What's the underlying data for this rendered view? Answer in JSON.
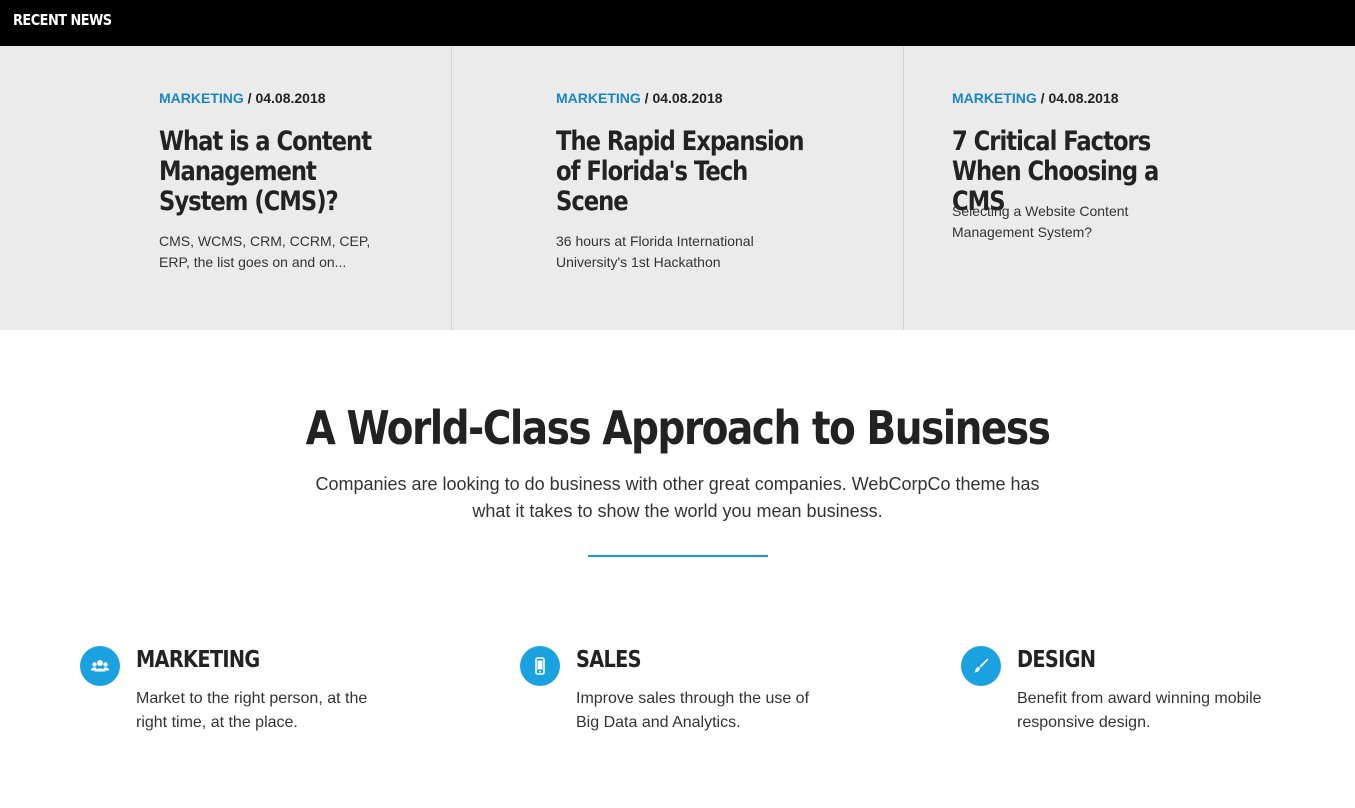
{
  "header": {
    "title": "RECENT NEWS"
  },
  "news": [
    {
      "category": "MARKETING",
      "separator": "/",
      "date": "04.08.2018",
      "title": "What is a Content Management System (CMS)?",
      "excerpt": "CMS, WCMS, CRM, CCRM, CEP, ERP, the list goes on and on..."
    },
    {
      "category": "MARKETING",
      "separator": "/",
      "date": "04.08.2018",
      "title": "The Rapid Expansion of Florida's Tech Scene",
      "excerpt": "36 hours at Florida International University's 1st Hackathon"
    },
    {
      "category": "MARKETING",
      "separator": "/",
      "date": "04.08.2018",
      "title": "7 Critical Factors When Choosing a CMS",
      "excerpt": "Selecting a Website Content Management System?"
    }
  ],
  "hero": {
    "title": "A World-Class Approach to Business",
    "subtitle": "Companies are looking to do business with other great companies. WebCorpCo theme has what it takes to show the world you mean business."
  },
  "features": [
    {
      "icon": "users-icon",
      "title": "MARKETING",
      "text": "Market to the right person, at the right time, at the place."
    },
    {
      "icon": "mobile-icon",
      "title": "SALES",
      "text": "Improve sales through the use of Big Data and Analytics."
    },
    {
      "icon": "brush-icon",
      "title": "DESIGN",
      "text": "Benefit from award winning mobile responsive design."
    }
  ],
  "colors": {
    "accent": "#1a86c8",
    "icon_circle": "#1aa1e0",
    "header_bg": "#000000",
    "news_bg": "#ebebeb"
  }
}
